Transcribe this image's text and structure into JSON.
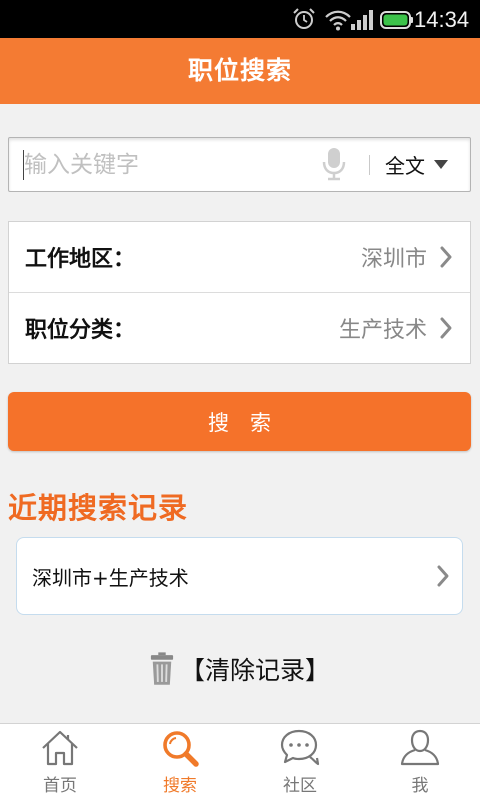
{
  "theme": {
    "header_bg": "#f47b33",
    "button_bg": "#f5722a",
    "accent": "#f07a2a",
    "recent_title_color": "#ef6a22",
    "page_bg": "#f1f1f1",
    "inactive_tab": "#777777",
    "battery": "#3cc24a",
    "record_border": "#c5dcee"
  },
  "status_bar": {
    "time": "14:34",
    "icons": [
      "alarm-icon",
      "wifi-icon",
      "signal-icon",
      "battery-icon"
    ]
  },
  "header": {
    "title": "职位搜索"
  },
  "search": {
    "placeholder": "输入关键字",
    "voice_icon": "microphone-icon",
    "scope_selected": "全文",
    "scope_icon": "dropdown-triangle-icon"
  },
  "filters": [
    {
      "label": "工作地区：",
      "value": "深圳市",
      "icon": "chevron-right-icon"
    },
    {
      "label": "职位分类：",
      "value": "生产技术",
      "icon": "chevron-right-icon"
    }
  ],
  "search_button": {
    "label": "搜　索"
  },
  "recent": {
    "title": "近期搜索记录",
    "items": [
      {
        "text": "深圳市+生产技术",
        "icon": "chevron-right-icon"
      }
    ],
    "clear_label": "【清除记录】",
    "clear_icon": "trash-icon"
  },
  "tabs": [
    {
      "label": "首页",
      "icon": "home-icon",
      "active": false
    },
    {
      "label": "搜索",
      "icon": "search-icon",
      "active": true
    },
    {
      "label": "社区",
      "icon": "chat-bubbles-icon",
      "active": false
    },
    {
      "label": "我",
      "icon": "profile-icon",
      "active": false
    }
  ]
}
